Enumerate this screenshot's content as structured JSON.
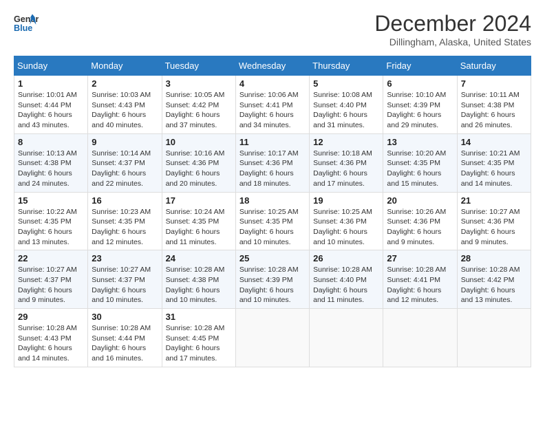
{
  "header": {
    "logo_line1": "General",
    "logo_line2": "Blue",
    "month_title": "December 2024",
    "subtitle": "Dillingham, Alaska, United States"
  },
  "weekdays": [
    "Sunday",
    "Monday",
    "Tuesday",
    "Wednesday",
    "Thursday",
    "Friday",
    "Saturday"
  ],
  "weeks": [
    [
      {
        "day": "1",
        "sunrise": "10:01 AM",
        "sunset": "4:44 PM",
        "daylight": "6 hours and 43 minutes."
      },
      {
        "day": "2",
        "sunrise": "10:03 AM",
        "sunset": "4:43 PM",
        "daylight": "6 hours and 40 minutes."
      },
      {
        "day": "3",
        "sunrise": "10:05 AM",
        "sunset": "4:42 PM",
        "daylight": "6 hours and 37 minutes."
      },
      {
        "day": "4",
        "sunrise": "10:06 AM",
        "sunset": "4:41 PM",
        "daylight": "6 hours and 34 minutes."
      },
      {
        "day": "5",
        "sunrise": "10:08 AM",
        "sunset": "4:40 PM",
        "daylight": "6 hours and 31 minutes."
      },
      {
        "day": "6",
        "sunrise": "10:10 AM",
        "sunset": "4:39 PM",
        "daylight": "6 hours and 29 minutes."
      },
      {
        "day": "7",
        "sunrise": "10:11 AM",
        "sunset": "4:38 PM",
        "daylight": "6 hours and 26 minutes."
      }
    ],
    [
      {
        "day": "8",
        "sunrise": "10:13 AM",
        "sunset": "4:38 PM",
        "daylight": "6 hours and 24 minutes."
      },
      {
        "day": "9",
        "sunrise": "10:14 AM",
        "sunset": "4:37 PM",
        "daylight": "6 hours and 22 minutes."
      },
      {
        "day": "10",
        "sunrise": "10:16 AM",
        "sunset": "4:36 PM",
        "daylight": "6 hours and 20 minutes."
      },
      {
        "day": "11",
        "sunrise": "10:17 AM",
        "sunset": "4:36 PM",
        "daylight": "6 hours and 18 minutes."
      },
      {
        "day": "12",
        "sunrise": "10:18 AM",
        "sunset": "4:36 PM",
        "daylight": "6 hours and 17 minutes."
      },
      {
        "day": "13",
        "sunrise": "10:20 AM",
        "sunset": "4:35 PM",
        "daylight": "6 hours and 15 minutes."
      },
      {
        "day": "14",
        "sunrise": "10:21 AM",
        "sunset": "4:35 PM",
        "daylight": "6 hours and 14 minutes."
      }
    ],
    [
      {
        "day": "15",
        "sunrise": "10:22 AM",
        "sunset": "4:35 PM",
        "daylight": "6 hours and 13 minutes."
      },
      {
        "day": "16",
        "sunrise": "10:23 AM",
        "sunset": "4:35 PM",
        "daylight": "6 hours and 12 minutes."
      },
      {
        "day": "17",
        "sunrise": "10:24 AM",
        "sunset": "4:35 PM",
        "daylight": "6 hours and 11 minutes."
      },
      {
        "day": "18",
        "sunrise": "10:25 AM",
        "sunset": "4:35 PM",
        "daylight": "6 hours and 10 minutes."
      },
      {
        "day": "19",
        "sunrise": "10:25 AM",
        "sunset": "4:36 PM",
        "daylight": "6 hours and 10 minutes."
      },
      {
        "day": "20",
        "sunrise": "10:26 AM",
        "sunset": "4:36 PM",
        "daylight": "6 hours and 9 minutes."
      },
      {
        "day": "21",
        "sunrise": "10:27 AM",
        "sunset": "4:36 PM",
        "daylight": "6 hours and 9 minutes."
      }
    ],
    [
      {
        "day": "22",
        "sunrise": "10:27 AM",
        "sunset": "4:37 PM",
        "daylight": "6 hours and 9 minutes."
      },
      {
        "day": "23",
        "sunrise": "10:27 AM",
        "sunset": "4:37 PM",
        "daylight": "6 hours and 10 minutes."
      },
      {
        "day": "24",
        "sunrise": "10:28 AM",
        "sunset": "4:38 PM",
        "daylight": "6 hours and 10 minutes."
      },
      {
        "day": "25",
        "sunrise": "10:28 AM",
        "sunset": "4:39 PM",
        "daylight": "6 hours and 10 minutes."
      },
      {
        "day": "26",
        "sunrise": "10:28 AM",
        "sunset": "4:40 PM",
        "daylight": "6 hours and 11 minutes."
      },
      {
        "day": "27",
        "sunrise": "10:28 AM",
        "sunset": "4:41 PM",
        "daylight": "6 hours and 12 minutes."
      },
      {
        "day": "28",
        "sunrise": "10:28 AM",
        "sunset": "4:42 PM",
        "daylight": "6 hours and 13 minutes."
      }
    ],
    [
      {
        "day": "29",
        "sunrise": "10:28 AM",
        "sunset": "4:43 PM",
        "daylight": "6 hours and 14 minutes."
      },
      {
        "day": "30",
        "sunrise": "10:28 AM",
        "sunset": "4:44 PM",
        "daylight": "6 hours and 16 minutes."
      },
      {
        "day": "31",
        "sunrise": "10:28 AM",
        "sunset": "4:45 PM",
        "daylight": "6 hours and 17 minutes."
      },
      null,
      null,
      null,
      null
    ]
  ]
}
